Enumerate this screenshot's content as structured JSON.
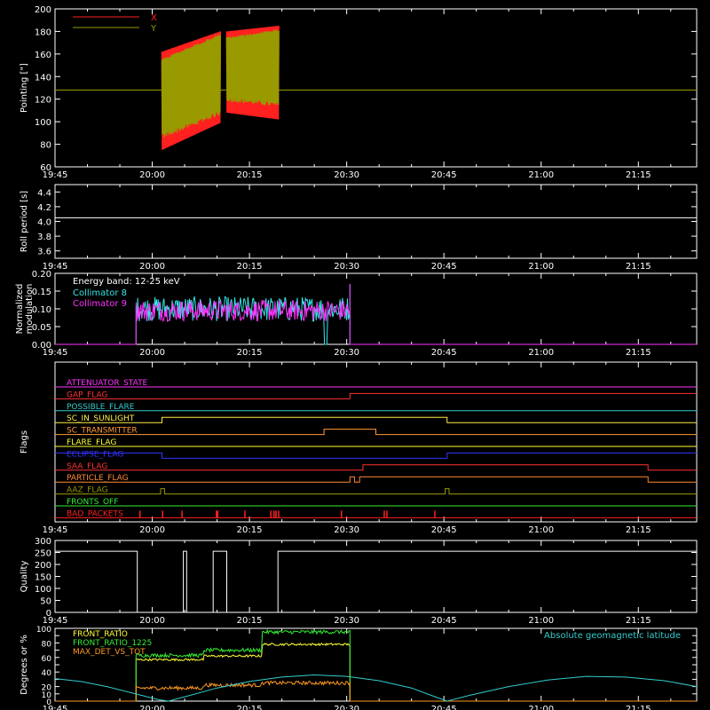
{
  "colors": {
    "background": "#000000",
    "axis": "#ffffff",
    "x_pointing": "#ff2020",
    "y_pointing": "#999900",
    "collimator_8": "#33e6e6",
    "collimator_9": "#ff33ff",
    "front_ratio": "#ffff33",
    "front_ratio_1225": "#33ee33",
    "max_det": "#ff9922",
    "geomag": "#33cccc"
  },
  "time_axis": {
    "start_min": 0,
    "end_min": 99,
    "tick_minutes": [
      0,
      15,
      30,
      45,
      60,
      75,
      90
    ],
    "tick_labels": [
      "19:45",
      "20:00",
      "20:15",
      "20:30",
      "20:45",
      "21:00",
      "21:15"
    ]
  },
  "chart_data": [
    {
      "type": "line",
      "ylabel": "Pointing [\"]",
      "ylim": [
        60,
        200
      ],
      "yticks": [
        60,
        80,
        100,
        120,
        140,
        160,
        180,
        200
      ],
      "legend": [
        "X",
        "Y"
      ],
      "reference_level": 128,
      "series": [
        {
          "name": "X",
          "segments": [
            {
              "x_range": [
                16.5,
                25.5
              ],
              "low_start": 75,
              "low_end": 99,
              "high_start": 162,
              "high_end": 180
            },
            {
              "x_range": [
                26.5,
                34.5
              ],
              "low_start": 108,
              "low_end": 102,
              "high_start": 180,
              "high_end": 185
            }
          ]
        },
        {
          "name": "Y",
          "segments": [
            {
              "x_range": [
                16.5,
                25.5
              ],
              "low_start": 85,
              "low_end": 106,
              "high_start": 156,
              "high_end": 178
            },
            {
              "x_range": [
                26.5,
                34.5
              ],
              "low_start": 118,
              "low_end": 113,
              "high_start": 175,
              "high_end": 182
            }
          ]
        }
      ]
    },
    {
      "type": "line",
      "ylabel": "Roll period [s]",
      "ylim": [
        3.5,
        4.5
      ],
      "yticks": [
        3.6,
        3.8,
        4.0,
        4.2,
        4.4
      ],
      "series": [
        {
          "name": "Roll period",
          "constant": 4.05,
          "x_range": [
            0,
            99
          ]
        }
      ]
    },
    {
      "type": "line",
      "ylabel": "Normalized modulation",
      "ylim": [
        0,
        0.2
      ],
      "yticks": [
        0.0,
        0.05,
        0.1,
        0.15,
        0.2
      ],
      "annotation": "Energy band: 12-25 keV",
      "legend": [
        "Collimator 8",
        "Collimator 9"
      ],
      "series": [
        {
          "name": "Collimator 8",
          "x_range": [
            12.5,
            45.5
          ],
          "mean": 0.1,
          "spread": 0.035,
          "dropouts": [
            [
              41.5,
              42.0
            ],
            [
              49.5,
              50.2
            ]
          ]
        },
        {
          "name": "Collimator 9",
          "x_range": [
            12.5,
            45.5
          ],
          "mean": 0.095,
          "spread": 0.03,
          "dropouts": []
        }
      ]
    },
    {
      "type": "line",
      "ylabel": "Flags",
      "flags": [
        {
          "name": "ATTENUATOR_STATE",
          "color": "#ff33ff",
          "highs": []
        },
        {
          "name": "GAP_FLAG",
          "color": "#ff3030",
          "highs": [
            [
              45.5,
              99
            ]
          ]
        },
        {
          "name": "POSSIBLE_FLARE",
          "color": "#33cccc",
          "highs": []
        },
        {
          "name": "SC_IN_SUNLIGHT",
          "color": "#ffee44",
          "highs": [
            [
              16.5,
              60.5
            ]
          ]
        },
        {
          "name": "SC_TRANSMITTER",
          "color": "#ff9933",
          "highs": [
            [
              41.5,
              49.5
            ]
          ]
        },
        {
          "name": "FLARE_FLAG",
          "color": "#ffff33",
          "highs": []
        },
        {
          "name": "ECLIPSE_FLAG",
          "color": "#3333ff",
          "highs": [
            [
              0,
              16.5
            ],
            [
              60.5,
              99
            ]
          ]
        },
        {
          "name": "SAA_FLAG",
          "color": "#ff3333",
          "highs": [
            [
              47.5,
              91.5
            ]
          ]
        },
        {
          "name": "PARTICLE_FLAG",
          "color": "#ff8833",
          "highs": [
            [
              45.5,
              46.2
            ],
            [
              47.0,
              91.5
            ]
          ]
        },
        {
          "name": "AAZ_FLAG",
          "color": "#999900",
          "highs": [
            [
              16.3,
              16.9
            ],
            [
              60.2,
              60.8
            ]
          ]
        },
        {
          "name": "FRONTS_OFF",
          "color": "#33ee33",
          "highs": []
        },
        {
          "name": "BAD_PACKETS",
          "color": "#ff2020",
          "highs": []
        }
      ],
      "bad_packet_spikes": [
        13.1,
        16.6,
        19.6,
        24.9,
        25.1,
        29.3,
        33.3,
        33.8,
        34.1,
        34.5,
        44.2,
        50.8,
        51.2,
        58.6
      ]
    },
    {
      "type": "line",
      "ylabel": "Quality",
      "ylim": [
        0,
        300
      ],
      "yticks": [
        0,
        50,
        100,
        150,
        200,
        250,
        300
      ],
      "series": [
        {
          "name": "Quality",
          "points": [
            [
              0,
              255
            ],
            [
              12.7,
              255
            ],
            [
              12.7,
              0
            ],
            [
              19.8,
              0
            ],
            [
              19.8,
              255
            ],
            [
              20.3,
              255
            ],
            [
              20.3,
              0
            ],
            [
              24.4,
              0
            ],
            [
              24.4,
              255
            ],
            [
              26.5,
              255
            ],
            [
              26.5,
              0
            ],
            [
              34.4,
              0
            ],
            [
              34.4,
              255
            ],
            [
              99,
              255
            ]
          ]
        }
      ]
    },
    {
      "type": "line",
      "ylabel": "Degrees or %",
      "ylim": [
        0,
        100
      ],
      "yticks": [
        0,
        10,
        20,
        30,
        40,
        50,
        60,
        70,
        80,
        90,
        100
      ],
      "legend": [
        "FRONT_RATIO",
        "FRONT_RATIO_1225",
        "MAX_DET_VS_TOT"
      ],
      "annotation": "Absolute geomagnetic latitude",
      "series": [
        {
          "name": "FRONT_RATIO",
          "x_range": [
            12.5,
            45.5
          ],
          "level_steps": [
            [
              12.5,
              57
            ],
            [
              23,
              62
            ],
            [
              32,
              78
            ],
            [
              50,
              72
            ]
          ],
          "noise": 3
        },
        {
          "name": "FRONT_RATIO_1225",
          "x_range": [
            12.5,
            45.5
          ],
          "level_steps": [
            [
              12.5,
              63
            ],
            [
              23,
              70
            ],
            [
              32,
              95
            ],
            [
              49,
              80
            ]
          ],
          "noise": 5
        },
        {
          "name": "MAX_DET_VS_TOT",
          "x_range": [
            12.5,
            45.5
          ],
          "level_steps": [
            [
              12.5,
              18
            ],
            [
              23,
              22
            ],
            [
              32,
              25
            ],
            [
              50,
              22
            ]
          ],
          "noise": 5
        },
        {
          "name": "Absolute geomagnetic latitude",
          "points": [
            [
              0,
              31
            ],
            [
              4,
              27
            ],
            [
              8,
              20
            ],
            [
              12,
              11
            ],
            [
              16,
              2
            ],
            [
              17.5,
              0
            ],
            [
              20,
              6
            ],
            [
              25,
              18
            ],
            [
              30,
              27
            ],
            [
              35,
              33
            ],
            [
              40,
              36
            ],
            [
              45,
              34
            ],
            [
              50,
              28
            ],
            [
              55,
              18
            ],
            [
              58,
              8
            ],
            [
              60.5,
              0
            ],
            [
              64,
              8
            ],
            [
              70,
              20
            ],
            [
              76,
              29
            ],
            [
              82,
              34
            ],
            [
              88,
              33
            ],
            [
              94,
              28
            ],
            [
              99,
              20
            ]
          ]
        }
      ]
    }
  ]
}
